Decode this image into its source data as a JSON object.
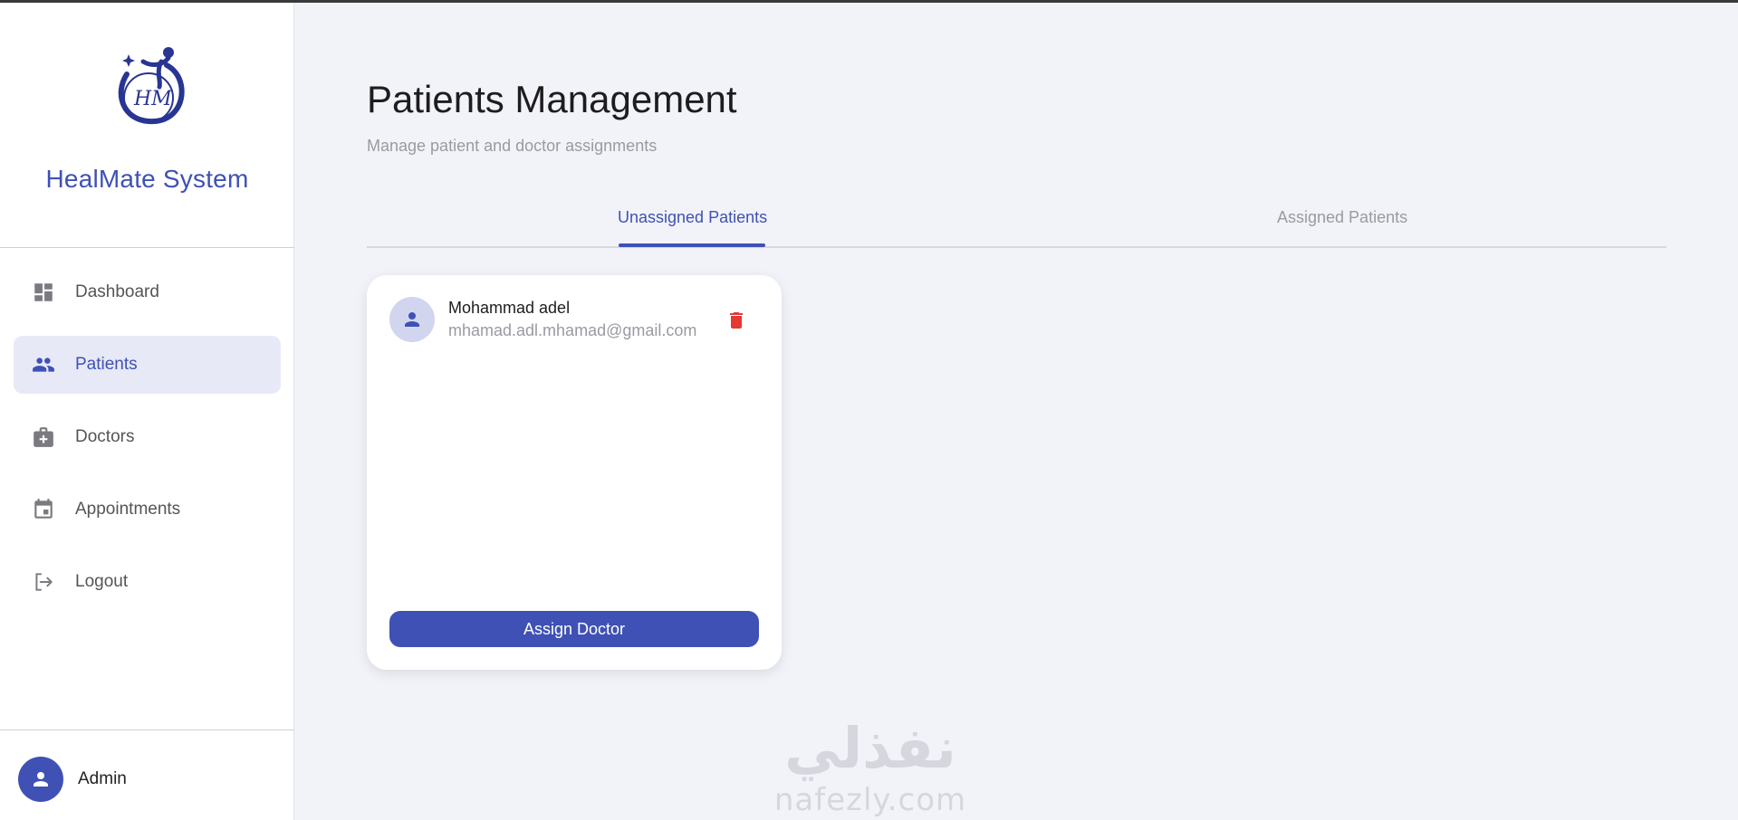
{
  "app": {
    "brand_name": "HealMate System",
    "logo_text": "HM"
  },
  "sidebar": {
    "items": [
      {
        "label": "Dashboard",
        "icon": "dashboard-icon",
        "active": false
      },
      {
        "label": "Patients",
        "icon": "people-icon",
        "active": true
      },
      {
        "label": "Doctors",
        "icon": "medical-bag-icon",
        "active": false
      },
      {
        "label": "Appointments",
        "icon": "calendar-icon",
        "active": false
      },
      {
        "label": "Logout",
        "icon": "logout-icon",
        "active": false
      }
    ],
    "user": {
      "name": "Admin",
      "icon": "person-icon"
    }
  },
  "main": {
    "title": "Patients Management",
    "subtitle": "Manage patient and doctor assignments",
    "tabs": [
      {
        "label": "Unassigned Patients",
        "active": true
      },
      {
        "label": "Assigned Patients",
        "active": false
      }
    ],
    "patients": [
      {
        "name": "Mohammad adel",
        "email": "mhamad.adl.mhamad@gmail.com",
        "action_label": "Assign Doctor"
      }
    ]
  },
  "watermark": {
    "arabic": "نفذلي",
    "latin": "nafezly.com"
  },
  "colors": {
    "primary": "#3f51b5",
    "active_bg": "#e7e9f7",
    "delete": "#e53935",
    "background": "#f2f3f9"
  }
}
